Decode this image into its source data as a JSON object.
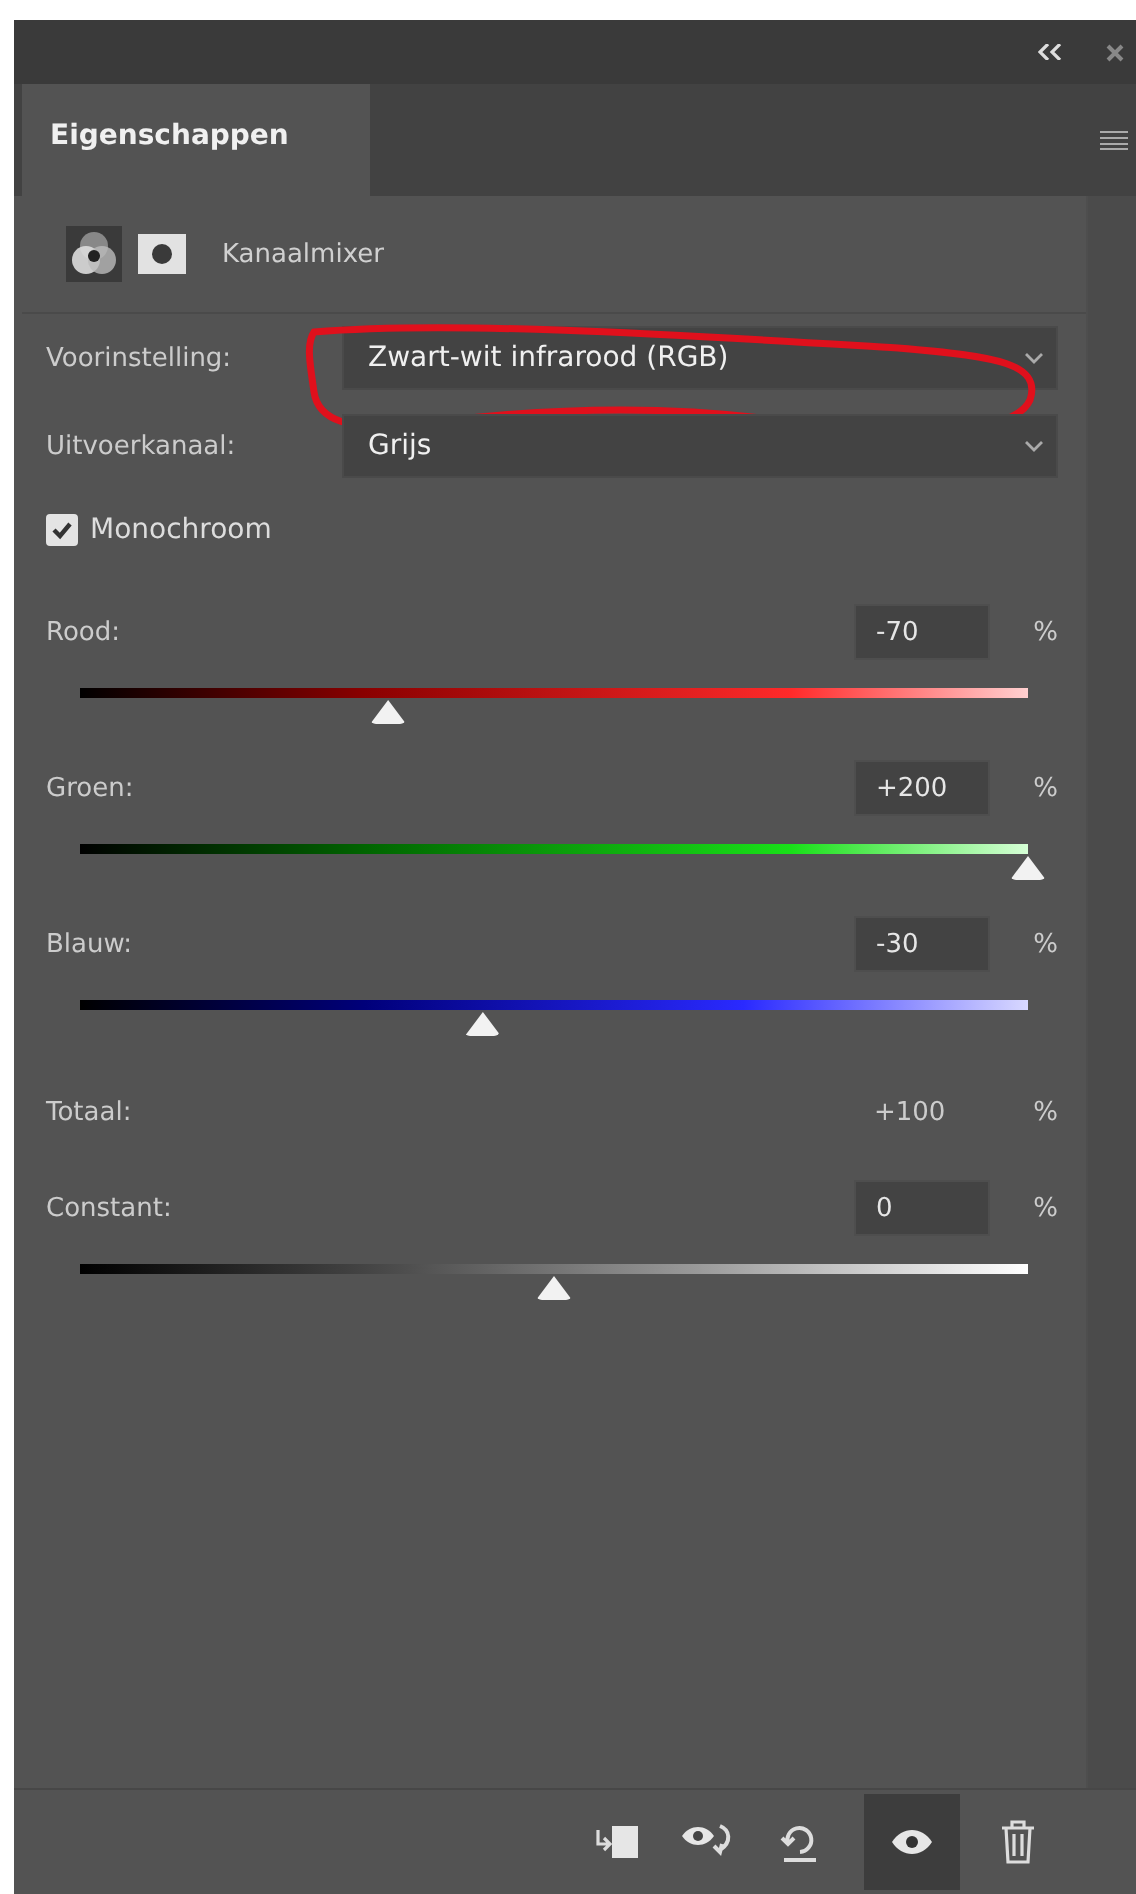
{
  "panel": {
    "tabs": [
      {
        "label": "Eigenschappen",
        "selected": true
      }
    ],
    "adjustment": {
      "title": "Kanaalmixer"
    }
  },
  "preset": {
    "label": "Voorinstelling:",
    "value": "Zwart-wit infrarood (RGB)",
    "annotated": true
  },
  "output_channel": {
    "label": "Uitvoerkanaal:",
    "value": "Grijs"
  },
  "monochrome": {
    "label": "Monochroom",
    "checked": true
  },
  "channels": [
    {
      "kind": "red",
      "label": "Rood:",
      "value": "-70",
      "unit": "%",
      "level": 0.325
    },
    {
      "kind": "green",
      "label": "Groen:",
      "value": "+200",
      "unit": "%",
      "level": 1.0
    },
    {
      "kind": "blue",
      "label": "Blauw:",
      "value": "-30",
      "unit": "%",
      "level": 0.425
    }
  ],
  "total": {
    "label": "Totaal:",
    "value": "+100",
    "unit": "%"
  },
  "constant": {
    "label": "Constant:",
    "value": "0",
    "unit": "%",
    "level": 0.5
  }
}
